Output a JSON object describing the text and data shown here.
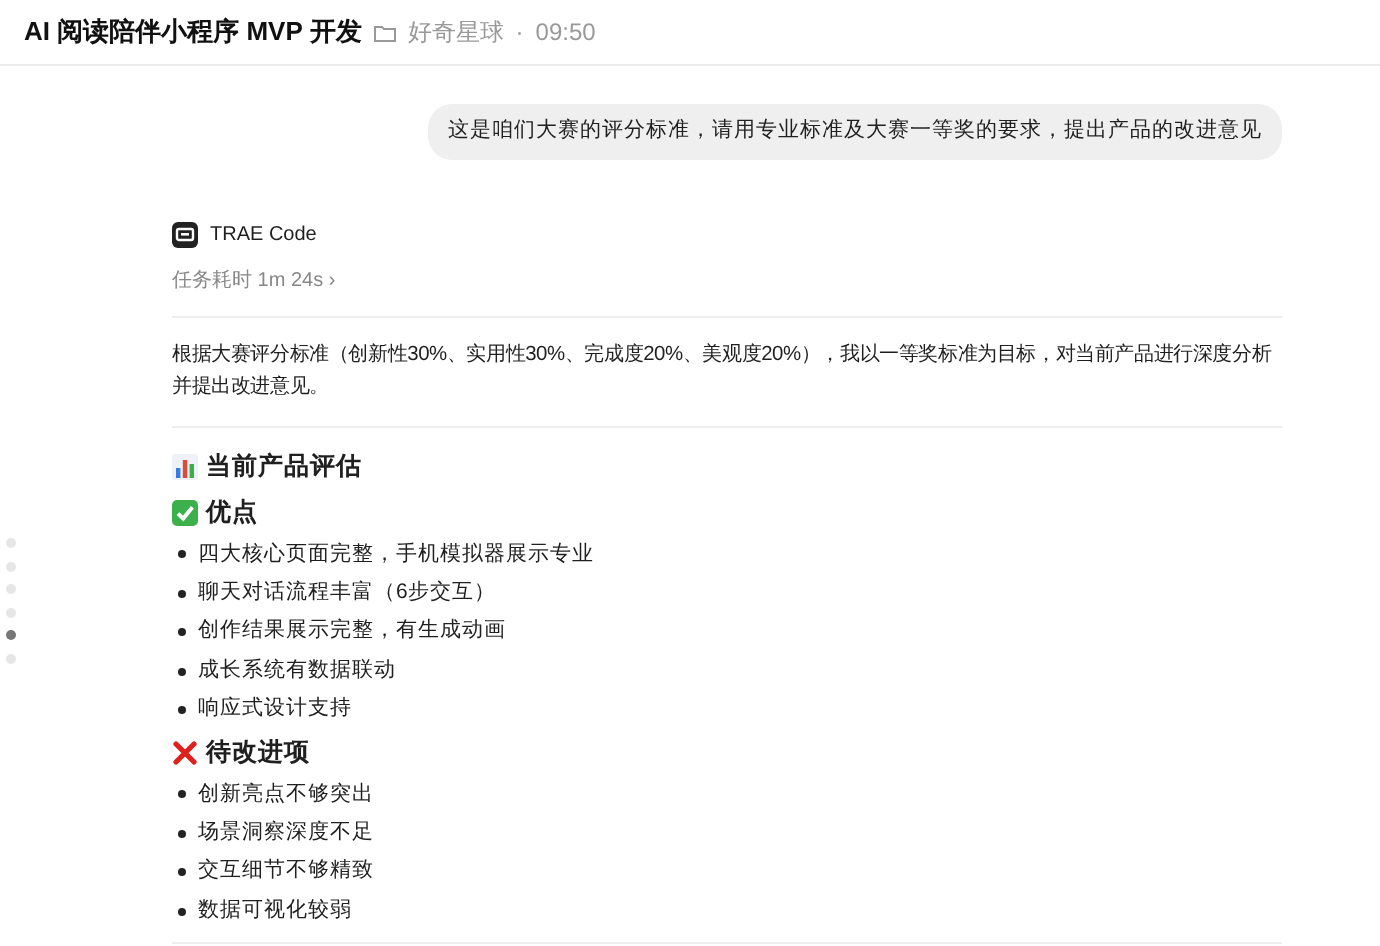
{
  "header": {
    "title": "AI 阅读陪伴小程序 MVP 开发",
    "project": "好奇星球",
    "separator": "·",
    "time": "09:50"
  },
  "user_message": "这是咱们大赛的评分标准，请用专业标准及大赛一等奖的要求，提出产品的改进意见",
  "page_dots": [
    {
      "selected": false
    },
    {
      "selected": false
    },
    {
      "selected": false
    },
    {
      "selected": false
    },
    {
      "selected": true
    },
    {
      "selected": false
    }
  ],
  "agent": {
    "name": "TRAE Code",
    "duration": "任务耗时 1m 24s",
    "chevron": "›"
  },
  "intro": "根据大赛评分标准（创新性30%、实用性30%、完成度20%、美观度20%），我以一等奖标准为目标，对当前产品进行深度分析并提出改进意见。",
  "sections": [
    {
      "kind": "chart",
      "heading": "当前产品评估"
    },
    {
      "kind": "check",
      "heading": "优点",
      "items": [
        "四大核心页面完整，手机模拟器展示专业",
        "聊天对话流程丰富（6步交互）",
        "创作结果展示完整，有生成动画",
        "成长系统有数据联动",
        "响应式设计支持"
      ]
    },
    {
      "kind": "cross",
      "heading": "待改进项",
      "items": [
        "创新亮点不够突出",
        "场景洞察深度不足",
        "交互细节不够精致",
        "数据可视化较弱"
      ]
    }
  ]
}
